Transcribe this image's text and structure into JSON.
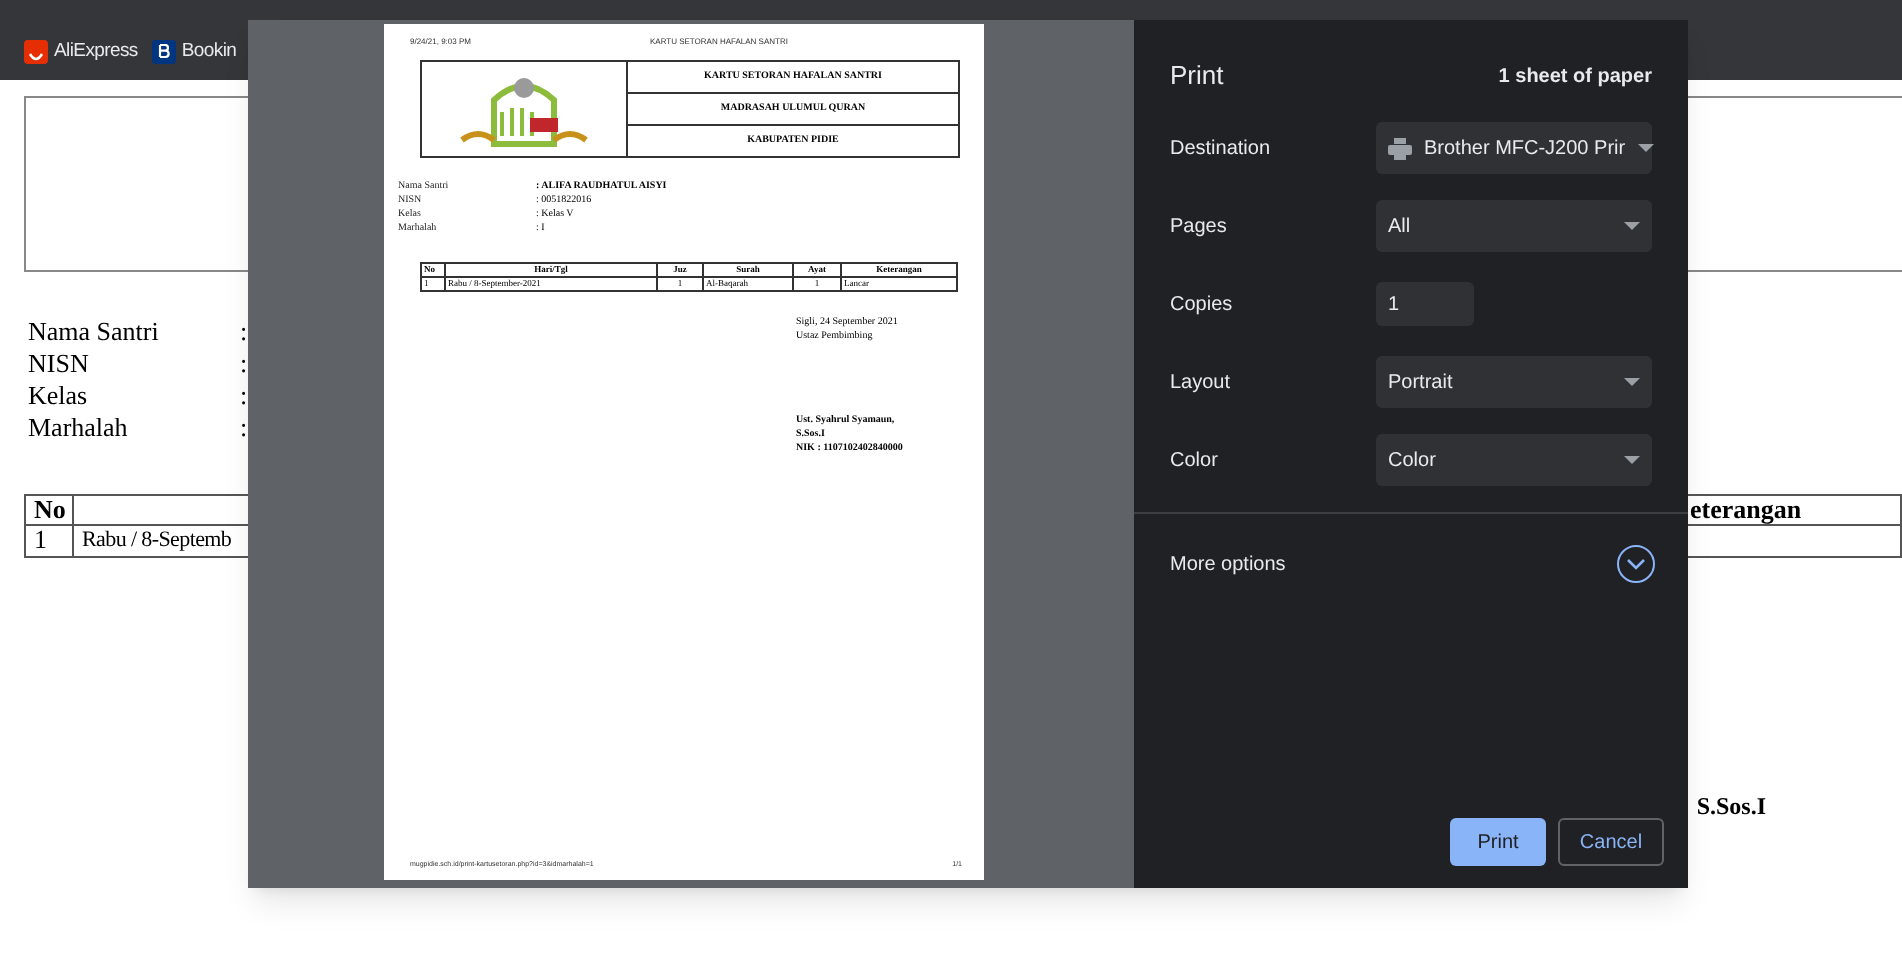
{
  "browser": {
    "bookmarks": [
      {
        "label": "AliExpress",
        "kind": "aliexpress"
      },
      {
        "label": "Bookin",
        "kind": "booking"
      }
    ]
  },
  "background_page": {
    "fields": [
      "Nama Santri",
      "NISN",
      "Kelas",
      "Marhalah"
    ],
    "separator": ":",
    "table_header": {
      "no": "No",
      "last_column": "eterangan"
    },
    "table_row": {
      "no": "1",
      "day_date": "Rabu / 8-Septemb"
    },
    "signer_degree": "S.Sos.I"
  },
  "preview": {
    "date": "9/24/21, 9:03 PM",
    "doc_title": "KARTU SETORAN HAFALAN SANTRI",
    "school_header": [
      "KARTU SETORAN HAFALAN SANTRI",
      "MADRASAH ULUMUL QURAN",
      "KABUPATEN PIDIE"
    ],
    "student": [
      {
        "label": "Nama Santri",
        "value": ": ALIFA RAUDHATUL AISYI",
        "bold": true
      },
      {
        "label": "NISN",
        "value": ": 0051822016",
        "bold": false
      },
      {
        "label": "Kelas",
        "value": ": Kelas V",
        "bold": false
      },
      {
        "label": "Marhalah",
        "value": ": I",
        "bold": false
      }
    ],
    "table": {
      "columns": [
        "No",
        "Hari/Tgl",
        "Juz",
        "Surah",
        "Ayat",
        "Keterangan"
      ],
      "rows": [
        [
          "1",
          "Rabu / 8-September-2021",
          "1",
          "Al-Baqarah",
          "1",
          "Lancar"
        ]
      ]
    },
    "place_date": "Sigli, 24 September 2021",
    "role": "Ustaz Pembimbing",
    "signer": [
      "Ust. Syahrul Syamaun,",
      "S.Sos.I",
      "NIK : 1107102402840000"
    ],
    "footer_url": "mugpidie.sch.id/print-kartusetoran.php?id=3&idmarhalah=1",
    "page_number": "1/1"
  },
  "print_dialog": {
    "title": "Print",
    "sheets": "1 sheet of paper",
    "settings": [
      {
        "label": "Destination",
        "kind": "printer",
        "value": "Brother MFC-J200 Prir"
      },
      {
        "label": "Pages",
        "kind": "select",
        "value": "All"
      },
      {
        "label": "Copies",
        "kind": "input",
        "value": "1"
      },
      {
        "label": "Layout",
        "kind": "select",
        "value": "Portrait"
      },
      {
        "label": "Color",
        "kind": "select",
        "value": "Color"
      }
    ],
    "more_options": {
      "label": "More options",
      "expanded": false
    },
    "buttons": [
      {
        "label": "Print",
        "kind": "primary"
      },
      {
        "label": "Cancel",
        "kind": "secondary"
      }
    ]
  }
}
